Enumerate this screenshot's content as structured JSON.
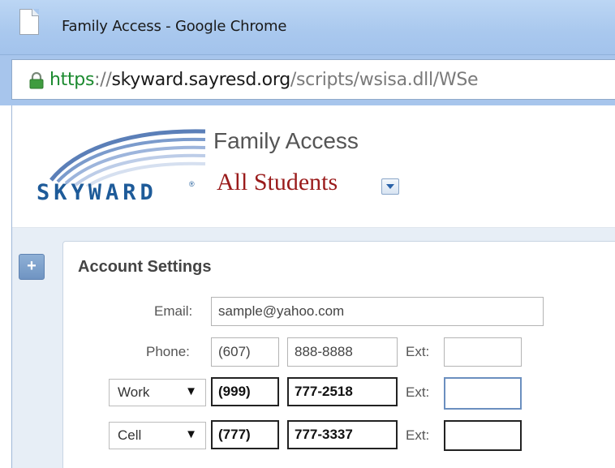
{
  "window": {
    "title": "Family Access - Google Chrome"
  },
  "address_bar": {
    "scheme": "https",
    "separator": "://",
    "host": "skyward.sayresd.org",
    "path": "/scripts/wsisa.dll/WSe"
  },
  "header": {
    "logo_text": "SKYWARD",
    "logo_reg": "®",
    "app_title": "Family Access",
    "student_selector": "All Students"
  },
  "sidebar": {
    "expand_label": "+"
  },
  "account_settings": {
    "title": "Account Settings",
    "email_label": "Email:",
    "email_value": "sample@yahoo.com",
    "phone_label": "Phone:",
    "phone_area": "(607)",
    "phone_number": "888-8888",
    "ext_label": "Ext:",
    "phone_ext": "",
    "extra_phones": [
      {
        "type": "Work",
        "area": "(999)",
        "number": "777-2518",
        "ext_label": "Ext:",
        "ext": ""
      },
      {
        "type": "Cell",
        "area": "(777)",
        "number": "777-3337",
        "ext_label": "Ext:",
        "ext": ""
      }
    ]
  },
  "colors": {
    "titlebar": "#a9c8ee",
    "url_scheme": "#1b8a2f",
    "student_selector": "#9a1b1b",
    "logo": "#1e5b99"
  },
  "icons": [
    "page-icon",
    "lock-icon",
    "skyward-logo",
    "chevron-down-icon",
    "plus-icon"
  ]
}
